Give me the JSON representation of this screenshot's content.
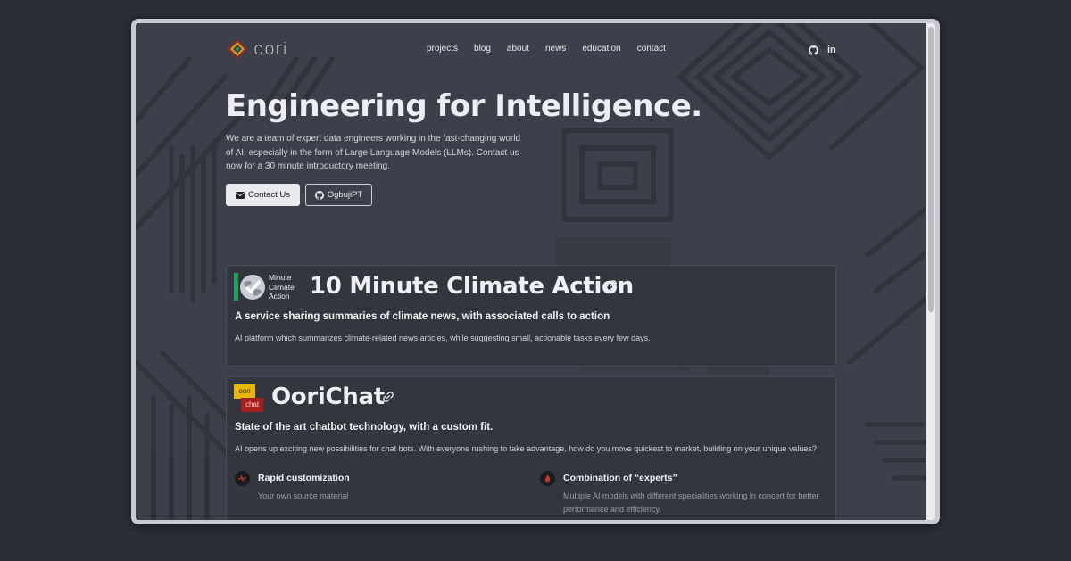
{
  "brand": {
    "name": "oori"
  },
  "nav": {
    "items": [
      "projects",
      "blog",
      "about",
      "news",
      "education",
      "contact"
    ]
  },
  "social": {
    "linkedin": "in"
  },
  "hero": {
    "title": "Engineering for Intelligence.",
    "description": "We are a team of expert data engineers working in the fast-changing world of AI, especially in the form of Large Language Models (LLMs). Contact us now for a 30 minute introductory meeting.",
    "contact_button": "Contact Us",
    "github_button": "OgbujiPT"
  },
  "projects": [
    {
      "logo_lines": [
        "Minute",
        "Climate",
        "Action"
      ],
      "title": "10 Minute Climate Action",
      "subtitle": "A service sharing summaries of climate news, with associated calls to action",
      "description": "AI platform which summarizes climate-related news articles, while suggesting small, actionable tasks every few days."
    },
    {
      "logo_top": "oori",
      "logo_bottom": "chat",
      "title": "OoriChat",
      "subtitle": "State of the art chatbot technology, with a custom fit.",
      "description": "AI opens up exciting new possibilities for chat bots. With everyone rushing to take advantage, how do you move quickest to market, building on your unique values?",
      "features": [
        {
          "title": "Rapid customization",
          "description": "Your own source material"
        },
        {
          "title": "Combination of “experts”",
          "description": "Multiple AI models with different specialities working in concert for better performance and efficiency."
        }
      ]
    }
  ],
  "colors": {
    "background": "#3d404a",
    "page_outer": "#2b2e37",
    "text": "#eceef3",
    "card": "#32353e"
  }
}
